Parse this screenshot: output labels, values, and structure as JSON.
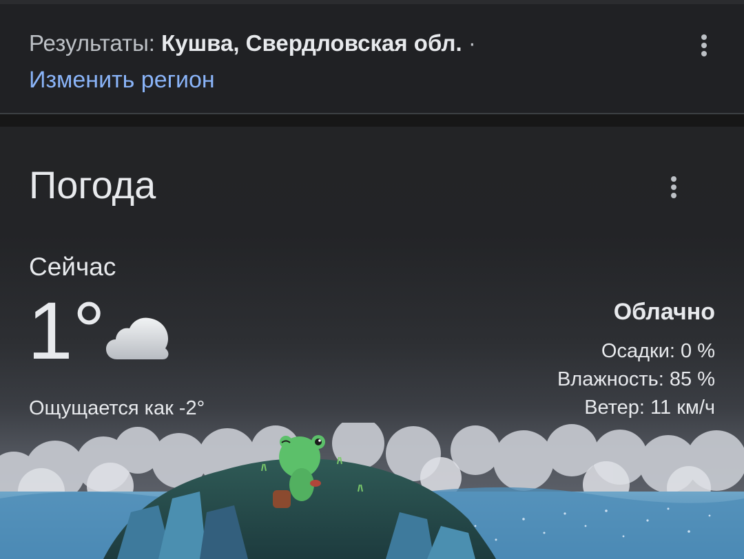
{
  "results": {
    "prefix": "Результаты: ",
    "location": "Кушва, Свердловская обл.",
    "separator": " ·",
    "change_region": "Изменить регион"
  },
  "weather": {
    "title": "Погода",
    "now_label": "Сейчас",
    "temperature": "1°",
    "condition_icon": "cloudy-icon",
    "feels_like": "Ощущается как -2°",
    "condition": "Облачно",
    "precipitation": "Осадки: 0 %",
    "humidity": "Влажность: 85 %",
    "wind": "Ветер: 11 км/ч"
  },
  "colors": {
    "background": "#202124",
    "link": "#8ab4f8",
    "text_primary": "#e8eaed",
    "text_secondary": "#bdc1c6",
    "frog": "#5cc06a"
  },
  "icons": [
    "more-vert-icon",
    "cloudy-icon",
    "frog-illustration"
  ]
}
